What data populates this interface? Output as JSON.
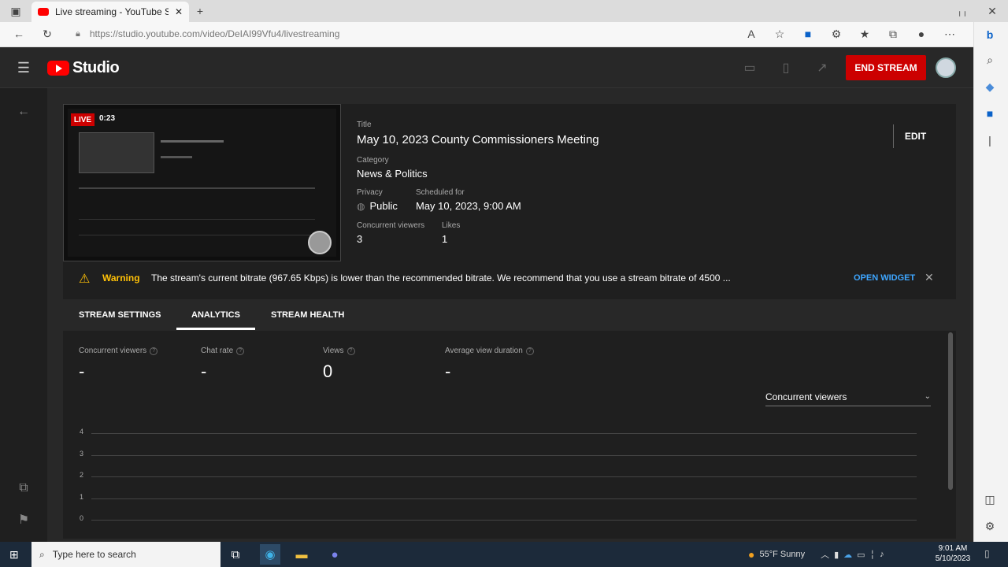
{
  "browser": {
    "tab_title": "Live streaming - YouTube Studio",
    "url": "https://studio.youtube.com/video/DeIAI99Vfu4/livestreaming"
  },
  "studio": {
    "logo_text": "Studio",
    "end_stream_label": "END STREAM"
  },
  "stream": {
    "live_badge": "LIVE",
    "elapsed": "0:23",
    "title_label": "Title",
    "title": "May 10, 2023 County Commissioners Meeting",
    "category_label": "Category",
    "category": "News & Politics",
    "privacy_label": "Privacy",
    "privacy": "Public",
    "scheduled_label": "Scheduled for",
    "scheduled": "May 10, 2023, 9:00 AM",
    "viewers_label": "Concurrent viewers",
    "viewers": "3",
    "likes_label": "Likes",
    "likes": "1",
    "edit_label": "EDIT"
  },
  "warning": {
    "label": "Warning",
    "message": "The stream's current bitrate (967.65 Kbps) is lower than the recommended bitrate. We recommend that you use a stream bitrate of 4500 ...",
    "action": "OPEN WIDGET"
  },
  "tabs": [
    "STREAM SETTINGS",
    "ANALYTICS",
    "STREAM HEALTH"
  ],
  "active_tab": "ANALYTICS",
  "metrics": [
    {
      "label": "Concurrent viewers",
      "value": "-"
    },
    {
      "label": "Chat rate",
      "value": "-"
    },
    {
      "label": "Views",
      "value": "0"
    },
    {
      "label": "Average view duration",
      "value": "-"
    }
  ],
  "chart_selector": "Concurrent viewers",
  "chart_data": {
    "type": "line",
    "title": "",
    "xlabel": "",
    "ylabel": "",
    "ylim": [
      0,
      4
    ],
    "yticks": [
      "4",
      "3",
      "2",
      "1",
      "0"
    ],
    "series": []
  },
  "taskbar": {
    "search_placeholder": "Type here to search",
    "weather": "55°F  Sunny",
    "time": "9:01 AM",
    "date": "5/10/2023"
  },
  "colors": {
    "brand_red": "#ff0000",
    "end_stream": "#cc0000",
    "warning_yellow": "#ffc107",
    "link_blue": "#3ea6ff"
  }
}
